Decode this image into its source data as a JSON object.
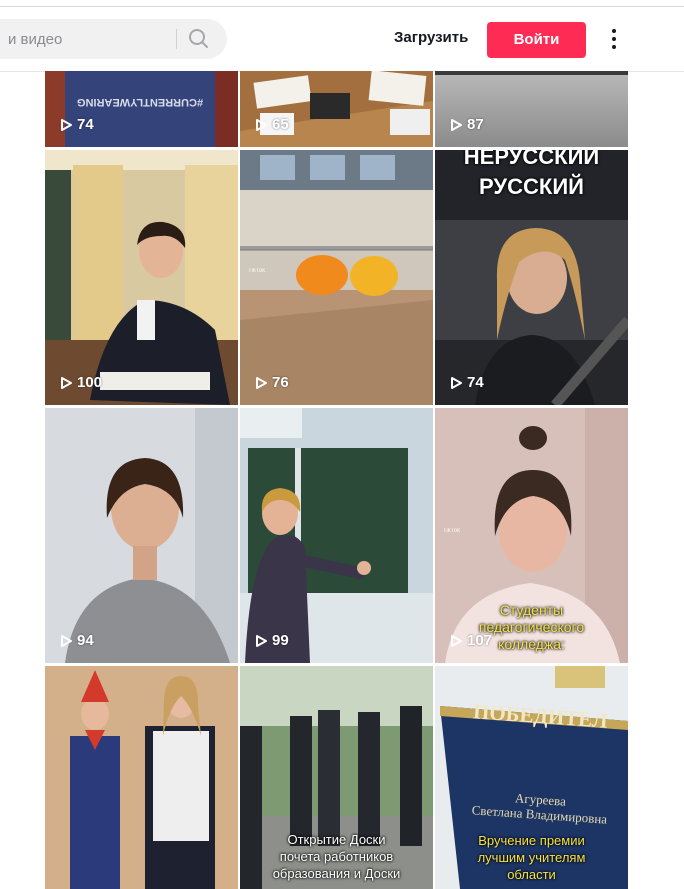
{
  "header": {
    "search_placeholder": "и видео",
    "upload_label": "Загрузить",
    "login_label": "Войти"
  },
  "colors": {
    "accent": "#fe2c55",
    "text": "#161823",
    "search_bg": "#f1f1f2"
  },
  "icons": {
    "search": "search-icon",
    "more": "more-vertical-icon",
    "play": "play-icon"
  },
  "videos": [
    {
      "views": "74"
    },
    {
      "views": "65"
    },
    {
      "views": "87"
    },
    {
      "views": "100"
    },
    {
      "views": "76",
      "watermark": "TikTok"
    },
    {
      "views": "74",
      "overlay": "РУССКИЙ",
      "overlay_top": "НЕРУССКИЙ"
    },
    {
      "views": "94"
    },
    {
      "views": "99"
    },
    {
      "views": "107",
      "watermark": "TikTok",
      "caption": [
        "Студенты",
        "педагогического",
        "колледжа:"
      ]
    },
    {
      "views": ""
    },
    {
      "views": "",
      "caption": [
        "Открытие Доски",
        "почета работников",
        "образования и Доски"
      ]
    },
    {
      "views": "",
      "plaque_title": "ПОБЕДИТЕЛ",
      "plaque_name": [
        "Агуреева",
        "Светлана Владимировна"
      ],
      "caption": [
        "Вручение премии",
        "лучшим учителям",
        "области"
      ]
    }
  ]
}
